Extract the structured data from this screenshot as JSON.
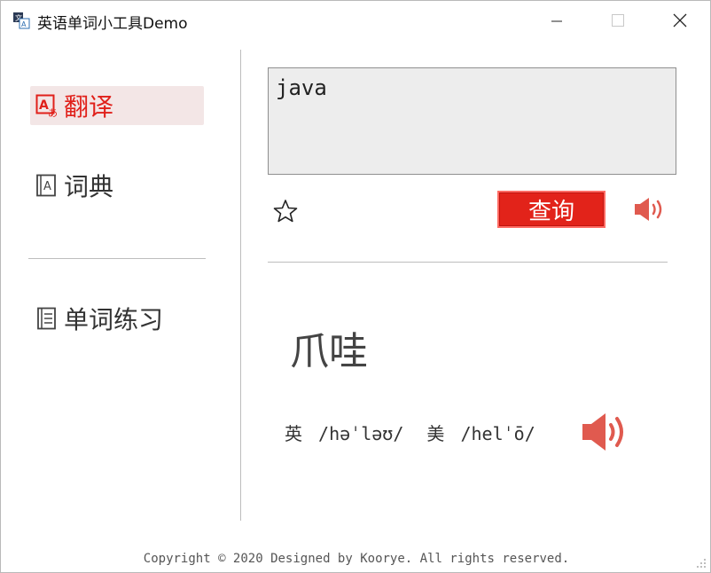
{
  "window": {
    "title": "英语单词小工具Demo",
    "controls": {
      "minimize": "minimize-icon",
      "maximize": "maximize-icon",
      "close": "close-icon"
    }
  },
  "sidebar": {
    "items": [
      {
        "label": "翻译",
        "icon": "translate-icon",
        "active": true
      },
      {
        "label": "词典",
        "icon": "dictionary-icon",
        "active": false
      },
      {
        "label": "单词练习",
        "icon": "practice-icon",
        "active": false
      }
    ]
  },
  "main": {
    "input_value": "java",
    "favorite_icon": "star-icon",
    "query_label": "查询",
    "speaker_icon": "speaker-icon",
    "result": {
      "word": "爪哇",
      "uk_label": "英",
      "uk_phonetic": "/həˈləʊ/",
      "us_label": "美",
      "us_phonetic": "/helˈō/"
    }
  },
  "footer": {
    "text": "Copyright © 2020 Designed by Koorye. All rights reserved."
  },
  "colors": {
    "accent": "#e2231a",
    "active_bg": "#f3e6e6",
    "speaker": "#e05a4f"
  }
}
